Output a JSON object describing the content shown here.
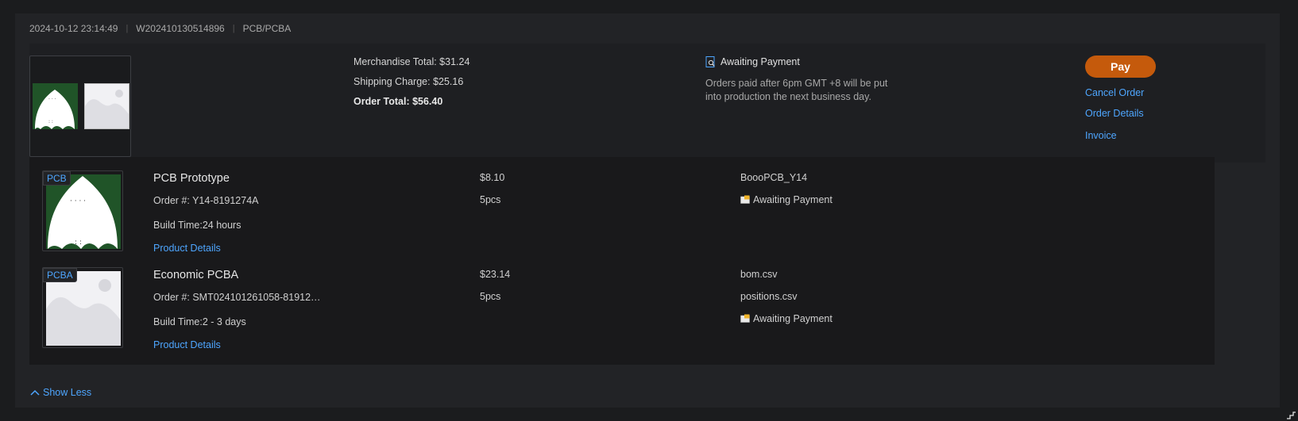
{
  "header": {
    "datetime": "2024-10-12 23:14:49",
    "order_no": "W202410130514896",
    "type": "PCB/PCBA"
  },
  "summary": {
    "merchandise_total": "Merchandise Total: $31.24",
    "shipping_charge": "Shipping Charge: $25.16",
    "order_total": "Order Total: $56.40",
    "status": "Awaiting Payment",
    "note": "Orders paid after 6pm GMT +8 will be put into production the next business day."
  },
  "actions": {
    "pay": "Pay",
    "cancel": "Cancel Order",
    "details": "Order Details",
    "invoice": "Invoice"
  },
  "items": [
    {
      "tag": "PCB",
      "name": "PCB Prototype",
      "order": "Order #: Y14-8191274A",
      "build_time": "Build Time:24 hours",
      "link": "Product Details",
      "price": "$8.10",
      "qty": "5pcs",
      "file1": "BoooPCB_Y14",
      "status": "Awaiting Payment"
    },
    {
      "tag": "PCBA",
      "name": "Economic PCBA",
      "order": "Order #: SMT024101261058-81912…",
      "build_time": "Build Time:2 - 3 days",
      "link": "Product Details",
      "price": "$23.14",
      "qty": "5pcs",
      "file1": "bom.csv",
      "file2": "positions.csv",
      "status": "Awaiting Payment"
    }
  ],
  "footer": {
    "show_less": "Show Less"
  },
  "colors": {
    "accent": "#4ea6ff",
    "pay": "#c55a0c",
    "board_green": "#205428"
  }
}
